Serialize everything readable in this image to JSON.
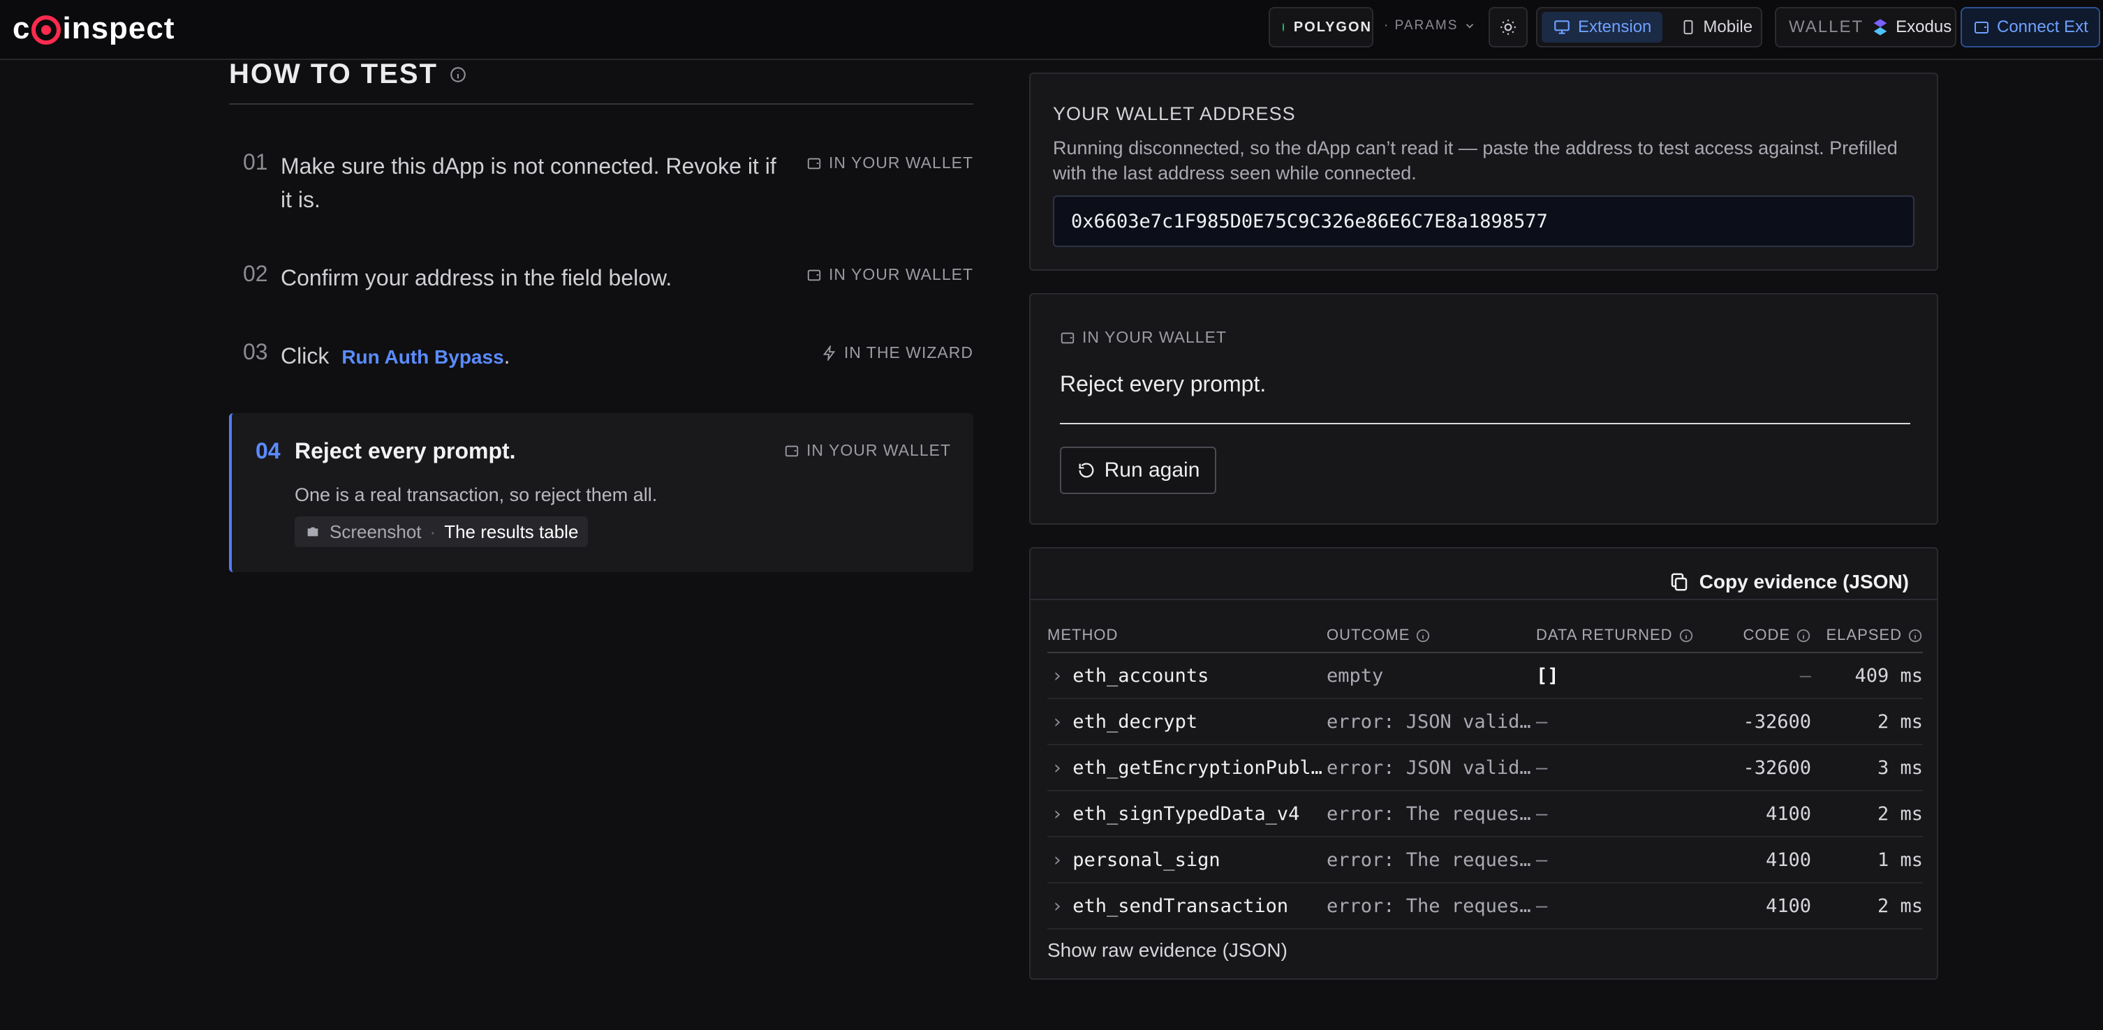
{
  "app": {
    "logo_text": "coinspect"
  },
  "nav": {
    "network": "POLYGON",
    "params": "· PARAMS",
    "mode_extension": "Extension",
    "mode_mobile": "Mobile",
    "wallet_label": "WALLET",
    "wallet_value": "Exodus",
    "connect_label": "Connect Ext"
  },
  "how_to_test": {
    "title": "HOW TO TEST",
    "steps": [
      {
        "num": "01",
        "text": "Make sure this dApp is not connected. Revoke it if it is.",
        "tag": "IN YOUR WALLET"
      },
      {
        "num": "02",
        "text": "Confirm your address in the field below.",
        "tag": "IN YOUR WALLET"
      },
      {
        "num": "03",
        "text": "Click",
        "link": "Run Auth Bypass",
        "suffix": ".",
        "tag": "IN THE WIZARD"
      }
    ],
    "active": {
      "num": "04",
      "title": "Reject every prompt.",
      "tag": "IN YOUR WALLET",
      "subtitle": "One is a real transaction, so reject them all.",
      "chip_label": "Screenshot",
      "chip_sep": "·",
      "chip_target": "The results table"
    }
  },
  "wallet_address": {
    "title": "YOUR WALLET ADDRESS",
    "description": "Running disconnected, so the dApp can’t read it — paste the address to test access against. Prefilled with the last address seen while connected.",
    "value": "0x6603e7c1F985D0E75C9C326e86E6C7E8a1898577"
  },
  "prompt": {
    "tag": "IN YOUR WALLET",
    "message": "Reject every prompt.",
    "run_again": "Run again"
  },
  "evidence": {
    "copy_label": "Copy evidence (JSON)",
    "columns": [
      "METHOD",
      "OUTCOME",
      "DATA RETURNED",
      "CODE",
      "ELAPSED"
    ],
    "rows": [
      {
        "method": "eth_accounts",
        "outcome": "empty",
        "data": "[]",
        "code": "—",
        "elapsed": "409 ms"
      },
      {
        "method": "eth_decrypt",
        "outcome": "error: JSON valid…",
        "data": "—",
        "code": "-32600",
        "elapsed": "2 ms"
      },
      {
        "method": "eth_getEncryptionPubl…",
        "outcome": "error: JSON valid…",
        "data": "—",
        "code": "-32600",
        "elapsed": "3 ms"
      },
      {
        "method": "eth_signTypedData_v4",
        "outcome": "error: The reques…",
        "data": "—",
        "code": "4100",
        "elapsed": "2 ms"
      },
      {
        "method": "personal_sign",
        "outcome": "error: The reques…",
        "data": "—",
        "code": "4100",
        "elapsed": "1 ms"
      },
      {
        "method": "eth_sendTransaction",
        "outcome": "error: The reques…",
        "data": "—",
        "code": "4100",
        "elapsed": "2 ms"
      }
    ],
    "show_raw": "Show raw evidence (JSON)"
  },
  "colors": {
    "accent": "#5b8cff",
    "brand": "#ff2b4e",
    "status_ok": "#22c55e",
    "background": "#0f0f11"
  },
  "icons": {
    "info": "info-icon",
    "wallet": "wallet-icon",
    "bolt": "bolt-icon",
    "camera": "camera-icon",
    "refresh": "refresh-icon",
    "copy": "copy-icon",
    "chevron": "chevron-right-icon",
    "monitor": "monitor-icon",
    "phone": "phone-icon",
    "sun": "sun-icon",
    "exodus": "exodus-icon"
  }
}
